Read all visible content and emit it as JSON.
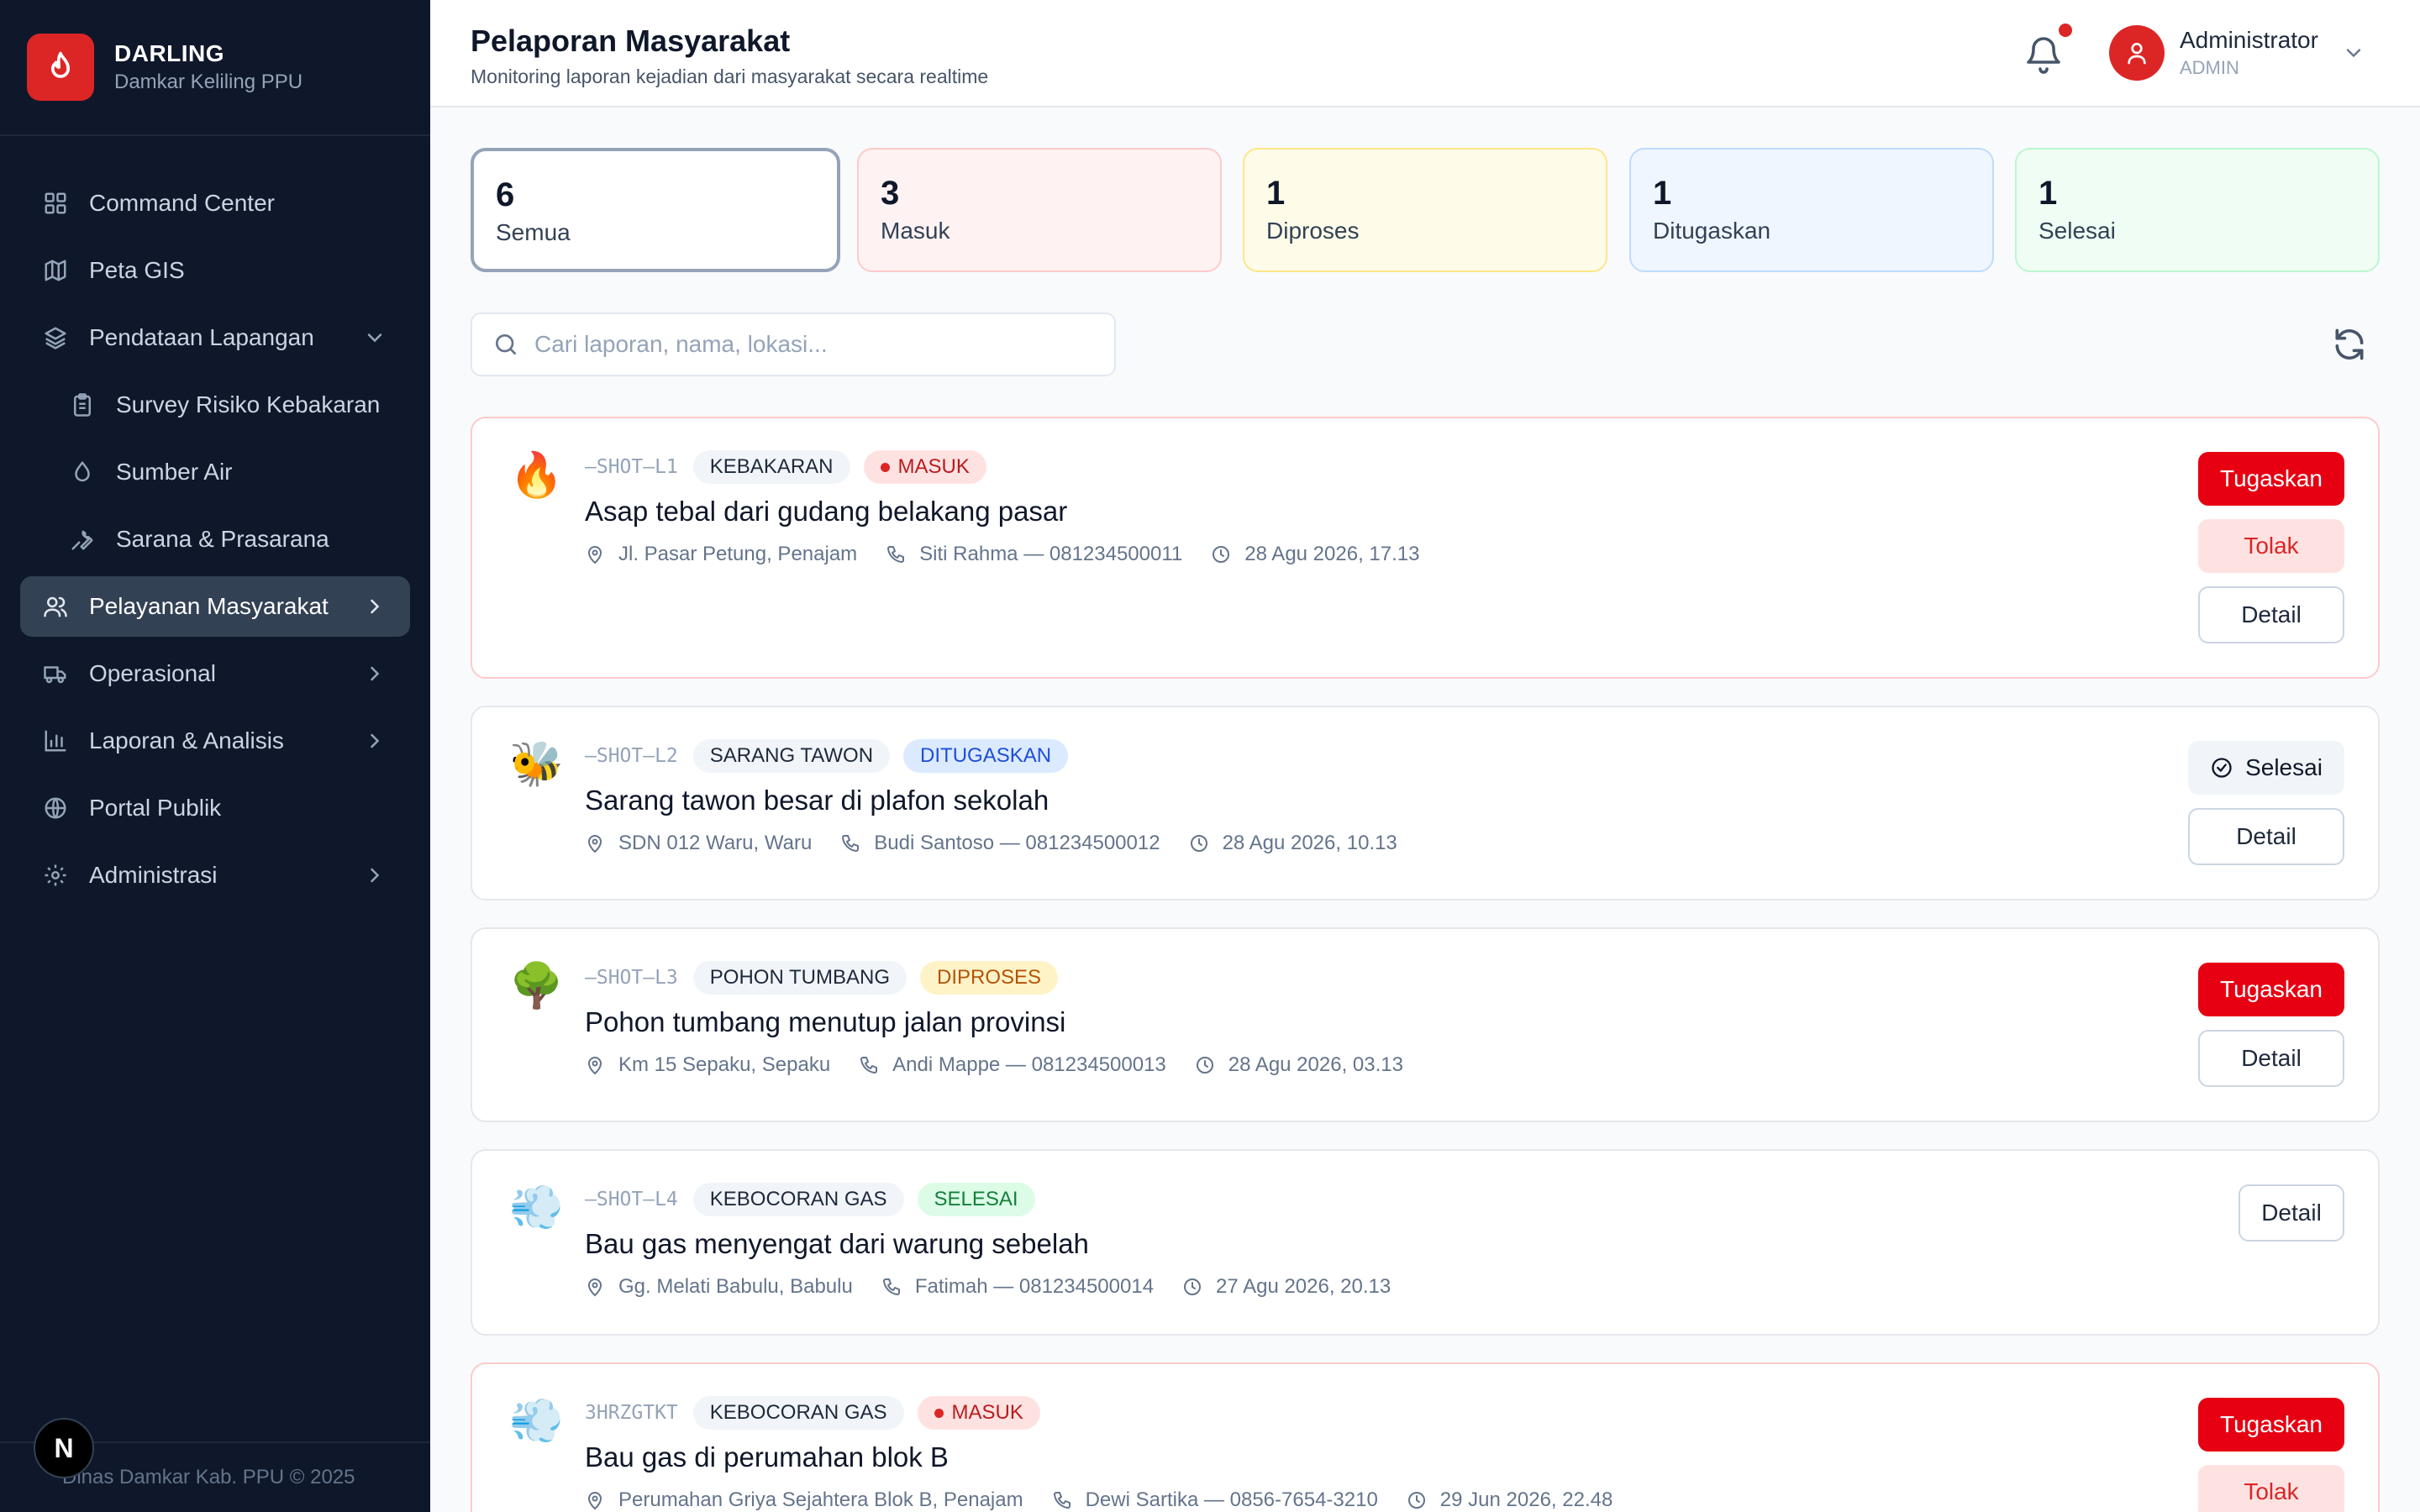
{
  "brand": {
    "title": "DARLING",
    "subtitle": "Damkar Keliling PPU"
  },
  "sidebar": {
    "items": [
      {
        "label": "Command Center",
        "icon": "grid-icon"
      },
      {
        "label": "Peta GIS",
        "icon": "map-icon"
      },
      {
        "label": "Pendataan Lapangan",
        "icon": "layers-icon"
      },
      {
        "label": "Survey Risiko Kebakaran",
        "icon": "clipboard-icon"
      },
      {
        "label": "Sumber Air",
        "icon": "droplet-icon"
      },
      {
        "label": "Sarana & Prasarana",
        "icon": "wrench-icon"
      },
      {
        "label": "Pelayanan Masyarakat",
        "icon": "users-icon"
      },
      {
        "label": "Operasional",
        "icon": "truck-icon"
      },
      {
        "label": "Laporan & Analisis",
        "icon": "bar-chart-icon"
      },
      {
        "label": "Portal Publik",
        "icon": "globe-icon"
      },
      {
        "label": "Administrasi",
        "icon": "gear-icon"
      }
    ],
    "footer": "Dinas Damkar Kab. PPU © 2025",
    "dev_badge": "N"
  },
  "header": {
    "title": "Pelaporan Masyarakat",
    "subtitle": "Monitoring laporan kejadian dari masyarakat secara realtime",
    "user_name": "Administrator",
    "user_role": "ADMIN"
  },
  "stats": [
    {
      "value": "6",
      "label": "Semua"
    },
    {
      "value": "3",
      "label": "Masuk"
    },
    {
      "value": "1",
      "label": "Diproses"
    },
    {
      "value": "1",
      "label": "Ditugaskan"
    },
    {
      "value": "1",
      "label": "Selesai"
    }
  ],
  "search": {
    "placeholder": "Cari laporan, nama, lokasi..."
  },
  "reports": [
    {
      "emoji": "🔥",
      "code": "—SHOT—L1",
      "type": "KEBAKARAN",
      "status": "MASUK",
      "title": "Asap tebal dari gudang belakang pasar",
      "location": "Jl. Pasar Petung, Penajam",
      "contact": "Siti Rahma — 081234500011",
      "time": "28 Agu 2026, 17.13"
    },
    {
      "emoji": "🐝",
      "code": "—SHOT—L2",
      "type": "SARANG TAWON",
      "status": "DITUGASKAN",
      "title": "Sarang tawon besar di plafon sekolah",
      "location": "SDN 012 Waru, Waru",
      "contact": "Budi Santoso — 081234500012",
      "time": "28 Agu 2026, 10.13"
    },
    {
      "emoji": "🌳",
      "code": "—SHOT—L3",
      "type": "POHON TUMBANG",
      "status": "DIPROSES",
      "title": "Pohon tumbang menutup jalan provinsi",
      "location": "Km 15 Sepaku, Sepaku",
      "contact": "Andi Mappe — 081234500013",
      "time": "28 Agu 2026, 03.13"
    },
    {
      "emoji": "💨",
      "code": "—SHOT—L4",
      "type": "KEBOCORAN GAS",
      "status": "SELESAI",
      "title": "Bau gas menyengat dari warung sebelah",
      "location": "Gg. Melati Babulu, Babulu",
      "contact": "Fatimah — 081234500014",
      "time": "27 Agu 2026, 20.13"
    },
    {
      "emoji": "💨",
      "code": "3HRZGTKT",
      "type": "KEBOCORAN GAS",
      "status": "MASUK",
      "title": "Bau gas di perumahan blok B",
      "location": "Perumahan Griya Sejahtera Blok B, Penajam",
      "contact": "Dewi Sartika — 0856-7654-3210",
      "time": "29 Jun 2026, 22.48"
    }
  ],
  "actions": {
    "assign": "Tugaskan",
    "reject": "Tolak",
    "detail": "Detail",
    "complete": "Selesai"
  },
  "colors": {
    "sidebar": "#0f172a",
    "accent": "#e60012",
    "masuk": "#fee2e2",
    "diproses": "#fef3c7",
    "ditugaskan": "#dbeafe",
    "selesai": "#dcfce7"
  }
}
